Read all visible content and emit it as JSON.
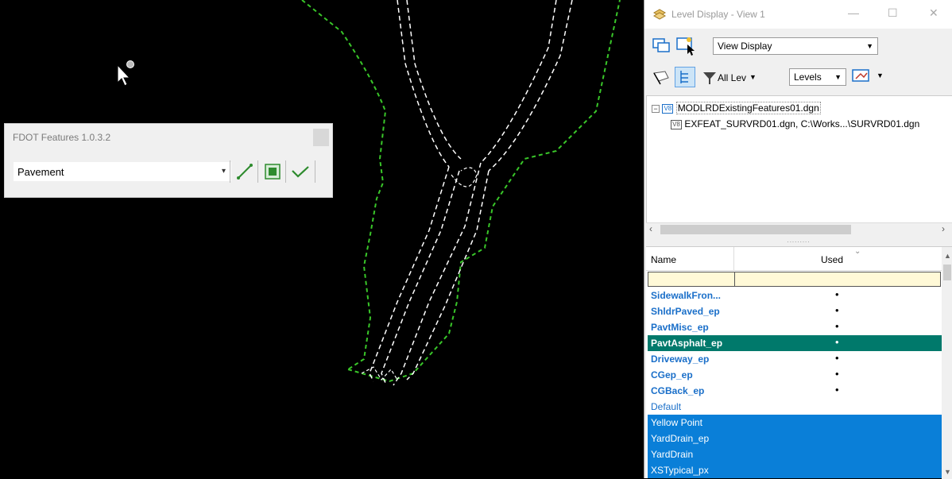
{
  "fdot_toolbar": {
    "title": "FDOT Features 1.0.3.2",
    "feature_value": "Pavement"
  },
  "level_display": {
    "title": "Level Display - View 1",
    "view_mode_value": "View Display",
    "filter_label": "All Lev",
    "levels_label": "Levels",
    "tree": {
      "root": "MODLRDExistingFeatures01.dgn",
      "child": "EXFEAT_SURVRD01.dgn, C:\\Works...\\SURVRD01.dgn"
    },
    "list": {
      "col_name": "Name",
      "col_used": "Used",
      "rows": [
        {
          "name": "SidewalkFron...",
          "used": "•"
        },
        {
          "name": "ShldrPaved_ep",
          "used": "•"
        },
        {
          "name": "PavtMisc_ep",
          "used": "•"
        },
        {
          "name": "PavtAsphalt_ep",
          "used": "•"
        },
        {
          "name": "Driveway_ep",
          "used": "•"
        },
        {
          "name": "CGep_ep",
          "used": "•"
        },
        {
          "name": "CGBack_ep",
          "used": "•"
        },
        {
          "name": "Default",
          "used": ""
        },
        {
          "name": "Yellow Point",
          "used": ""
        },
        {
          "name": "YardDrain_ep",
          "used": ""
        },
        {
          "name": "YardDrain",
          "used": ""
        },
        {
          "name": "XSTypical_px",
          "used": ""
        }
      ]
    }
  },
  "colors": {
    "canvas_bg": "#000000",
    "green_line": "#39c629",
    "active_level": "#00796b",
    "selected_level": "#0a7fd8",
    "level_text": "#1a6fc9"
  }
}
